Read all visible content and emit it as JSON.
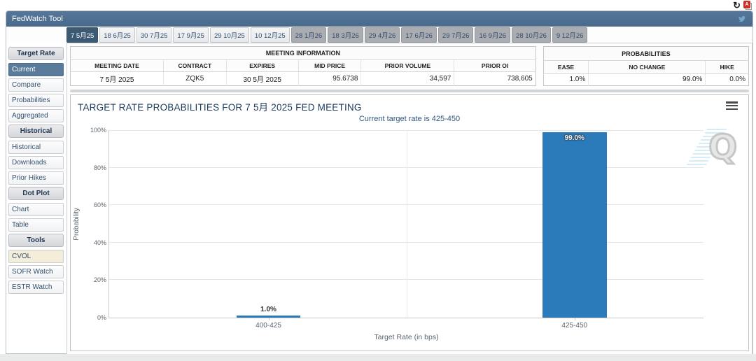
{
  "topbar": {
    "refresh_icon": "↻",
    "pdf_icon_label": "A"
  },
  "header": {
    "title": "FedWatch Tool"
  },
  "tabs": [
    {
      "label": "7 5月25",
      "state": "selected"
    },
    {
      "label": "18 6月25",
      "state": "light"
    },
    {
      "label": "30 7月25",
      "state": "light"
    },
    {
      "label": "17 9月25",
      "state": "light"
    },
    {
      "label": "29 10月25",
      "state": "light"
    },
    {
      "label": "10 12月25",
      "state": "light"
    },
    {
      "label": "28 1月26",
      "state": "gray"
    },
    {
      "label": "18 3月26",
      "state": "gray"
    },
    {
      "label": "29 4月26",
      "state": "gray"
    },
    {
      "label": "17 6月26",
      "state": "gray"
    },
    {
      "label": "29 7月26",
      "state": "gray"
    },
    {
      "label": "16 9月26",
      "state": "gray"
    },
    {
      "label": "28 10月26",
      "state": "gray"
    },
    {
      "label": "9 12月26",
      "state": "gray"
    }
  ],
  "sidebar": {
    "sections": [
      {
        "header": "Target Rate",
        "items": [
          {
            "label": "Current",
            "state": "selected"
          },
          {
            "label": "Compare",
            "state": "normal"
          },
          {
            "label": "Probabilities",
            "state": "normal"
          },
          {
            "label": "Aggregated",
            "state": "normal"
          }
        ]
      },
      {
        "header": "Historical",
        "items": [
          {
            "label": "Historical",
            "state": "normal"
          },
          {
            "label": "Downloads",
            "state": "normal"
          },
          {
            "label": "Prior Hikes",
            "state": "normal"
          }
        ]
      },
      {
        "header": "Dot Plot",
        "items": [
          {
            "label": "Chart",
            "state": "normal"
          },
          {
            "label": "Table",
            "state": "normal"
          }
        ]
      },
      {
        "header": "Tools",
        "items": [
          {
            "label": "CVOL",
            "state": "highlight"
          },
          {
            "label": "SOFR Watch",
            "state": "normal"
          },
          {
            "label": "ESTR Watch",
            "state": "normal"
          }
        ]
      }
    ]
  },
  "meeting_table": {
    "title": "MEETING INFORMATION",
    "columns": [
      "MEETING DATE",
      "CONTRACT",
      "EXPIRES",
      "MID PRICE",
      "PRIOR VOLUME",
      "PRIOR OI"
    ],
    "row": [
      "7 5月 2025",
      "ZQK5",
      "30 5月 2025",
      "95.6738",
      "34,597",
      "738,605"
    ]
  },
  "probabilities_table": {
    "title": "PROBABILITIES",
    "columns": [
      "EASE",
      "NO CHANGE",
      "HIKE"
    ],
    "row": [
      "1.0%",
      "99.0%",
      "0.0%"
    ]
  },
  "chart_data": {
    "type": "bar",
    "title": "TARGET RATE PROBABILITIES FOR 7 5月 2025 FED MEETING",
    "subtitle": "Current target rate is 425-450",
    "categories": [
      "400-425",
      "425-450"
    ],
    "values": [
      1.0,
      99.0
    ],
    "value_labels": [
      "1.0%",
      "99.0%"
    ],
    "xlabel": "Target Rate (in bps)",
    "ylabel": "Probability",
    "ylim": [
      0,
      100
    ],
    "yticks": [
      "0%",
      "20%",
      "40%",
      "60%",
      "80%",
      "100%"
    ],
    "grid": true,
    "legend": "none",
    "bar_color": "#2b7bba",
    "watermark": "Q"
  },
  "colors": {
    "header_bar": "#4e6f92",
    "selected_tab": "#3d5a75",
    "sidebar_selected": "#5b7b9b",
    "bar": "#2b7bba",
    "pdf_icon_red": "#ca3028",
    "twitter_blue": "#72a9cc"
  }
}
